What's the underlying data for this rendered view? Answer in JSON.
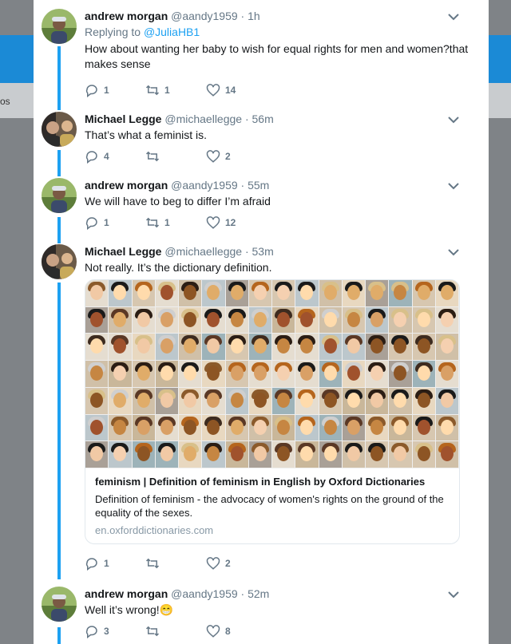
{
  "background": {
    "band_text": "os"
  },
  "tweets": [
    {
      "name": "andrew morgan",
      "handle": "@aandy1959",
      "time": "· 1h",
      "replying_prefix": "Replying to",
      "replying_to": "@JuliaHB1",
      "text": "How about wanting her baby to wish for equal rights for men and women?that makes sense",
      "replies": "1",
      "retweets": "1",
      "likes": "14"
    },
    {
      "name": "Michael Legge",
      "handle": "@michaellegge",
      "time": "· 56m",
      "text": "That’s what a feminist is.",
      "replies": "4",
      "retweets": "",
      "likes": "2"
    },
    {
      "name": "andrew morgan",
      "handle": "@aandy1959",
      "time": "· 55m",
      "text": "We will have to beg to differ I’m afraid",
      "replies": "1",
      "retweets": "1",
      "likes": "12"
    },
    {
      "name": "Michael Legge",
      "handle": "@michaellegge",
      "time": "· 53m",
      "text": "Not really. It’s the dictionary definition.",
      "card": {
        "title": "feminism | Definition of feminism in English by Oxford Dictionaries",
        "description": "Definition of feminism - the advocacy of women's rights on the ground of the equality of the sexes.",
        "domain": "en.oxforddictionaries.com"
      },
      "replies": "1",
      "retweets": "",
      "likes": "2"
    },
    {
      "name": "andrew morgan",
      "handle": "@aandy1959",
      "time": "· 52m",
      "text": "Well it’s wrong!😁",
      "replies": "3",
      "retweets": "",
      "likes": "8"
    }
  ],
  "icons": {
    "reply": "reply-icon",
    "retweet": "retweet-icon",
    "like": "heart-icon",
    "more": "chevron-down-icon"
  },
  "colors": {
    "accent": "#1da1f2",
    "header": "#1b8ad6",
    "muted": "#657786"
  }
}
